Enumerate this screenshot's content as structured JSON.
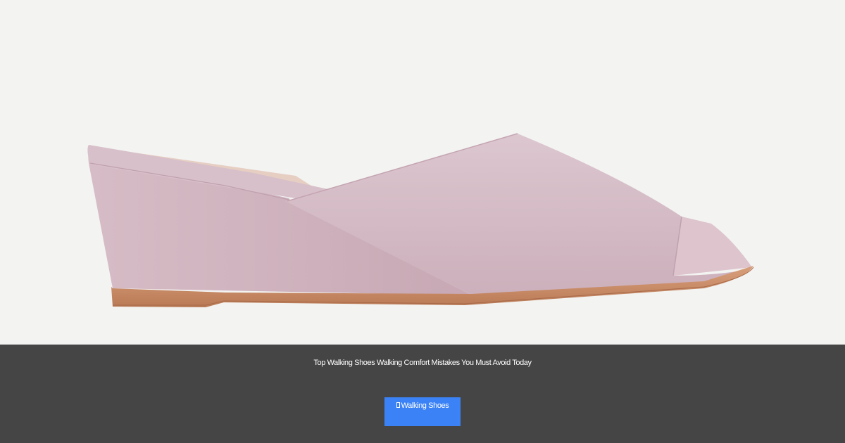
{
  "hero": {
    "image_subject": "lavender leather wedge slide sandal"
  },
  "footer": {
    "headline": "Top Walking Shoes Walking Comfort Mistakes You Must Avoid Today",
    "cta_label": "Walking Shoes",
    "cta_icon": "missing-glyph-icon"
  },
  "colors": {
    "background": "#f3f3f2",
    "bar": "#454545",
    "button": "#3b82f6",
    "text": "#ffffff"
  }
}
